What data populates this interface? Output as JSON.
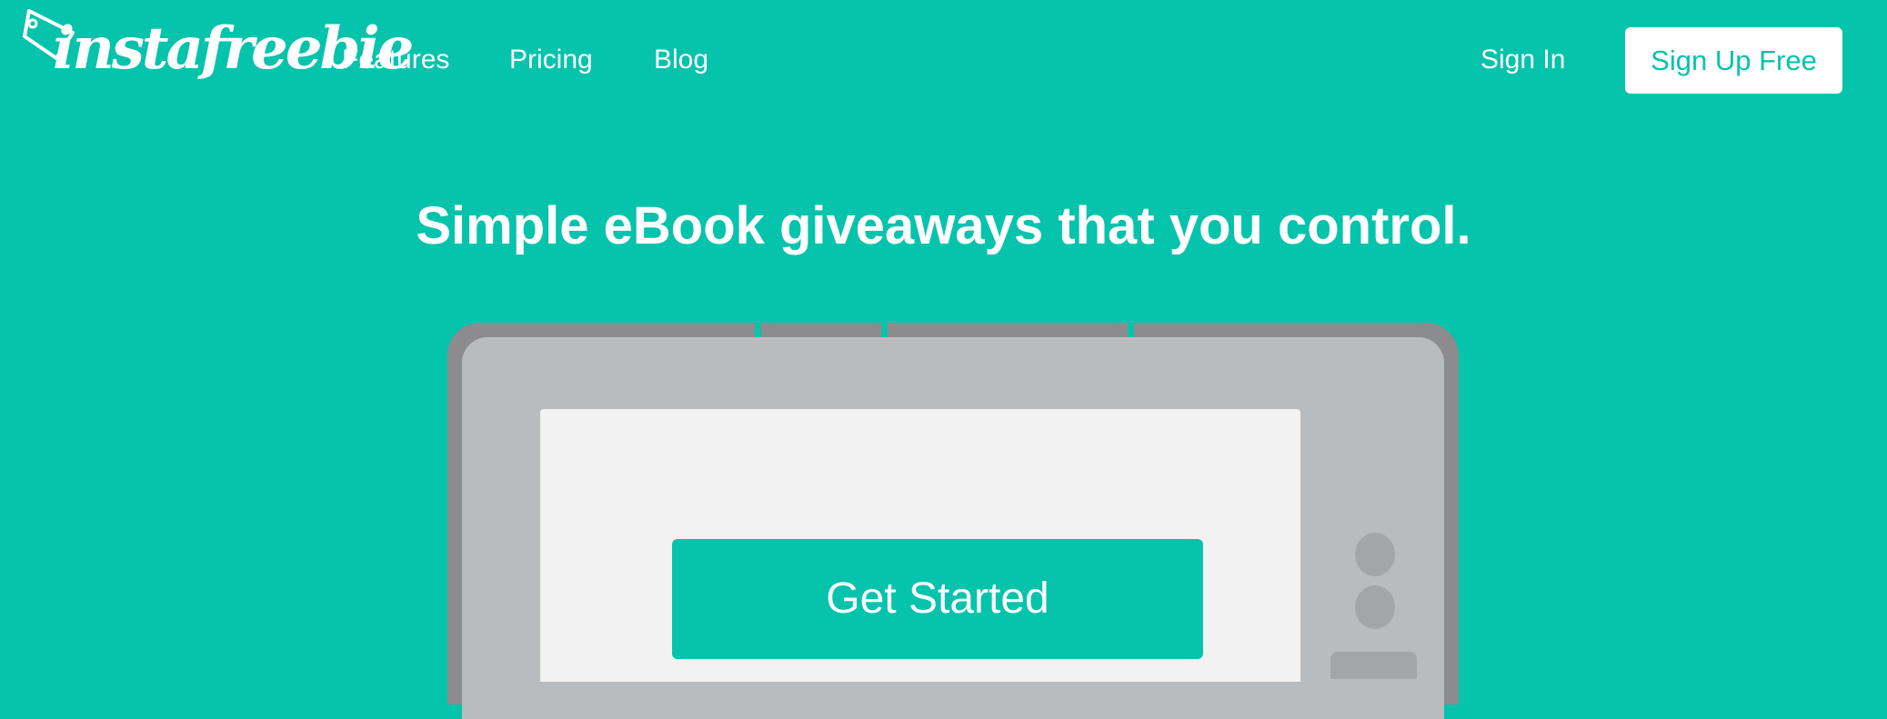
{
  "brand": {
    "logo_text": "instafreebie",
    "logo_icon": "price-tag-icon"
  },
  "nav": {
    "features": "Features",
    "pricing": "Pricing",
    "blog": "Blog",
    "sign_in": "Sign In",
    "sign_up": "Sign Up Free"
  },
  "hero": {
    "headline": "Simple eBook giveaways that you control.",
    "cta_label": "Get Started"
  },
  "colors": {
    "brand_teal": "#06c3ac",
    "white": "#ffffff",
    "device_frame": "#8c8c8f",
    "device_face": "#b9bcbe",
    "screen": "#f2f2f2",
    "device_buttons": "#a3a5a8"
  }
}
